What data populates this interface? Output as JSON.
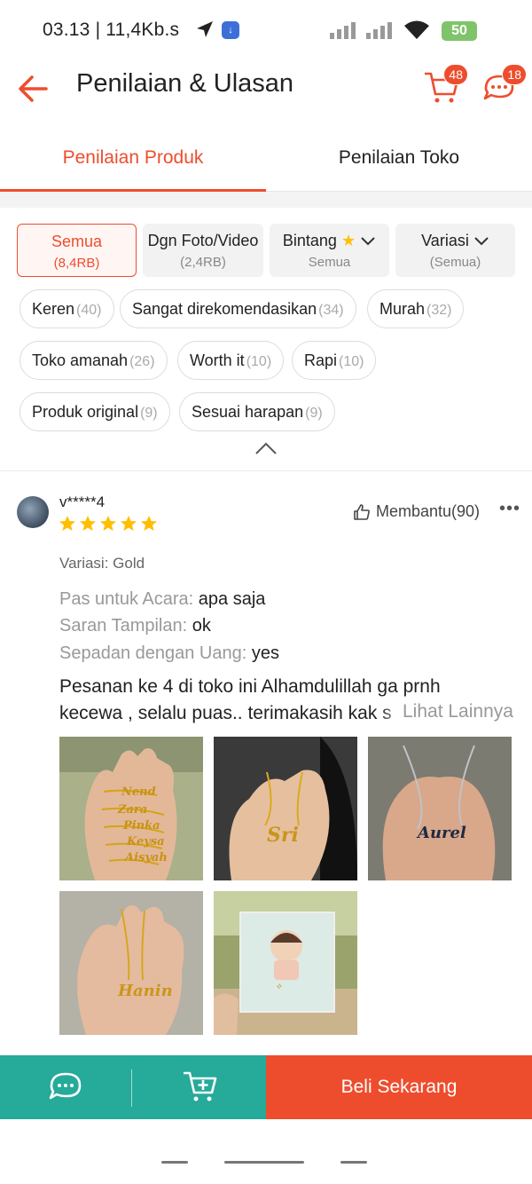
{
  "status_bar": {
    "time": "03.13 | 11,4Kb.s",
    "battery": "50"
  },
  "header": {
    "title": "Penilaian & Ulasan",
    "cart_count": "48",
    "chat_count": "18"
  },
  "tabs": [
    {
      "label": "Penilaian Produk",
      "active": true
    },
    {
      "label": "Penilaian Toko",
      "active": false
    }
  ],
  "filters": [
    {
      "label": "Semua",
      "sub": "(8,4RB)",
      "active": true
    },
    {
      "label": "Dgn Foto/Video",
      "sub": "(2,4RB)",
      "active": false
    },
    {
      "label": "Bintang",
      "sub": "Semua",
      "active": false
    },
    {
      "label": "Variasi",
      "sub": "(Semua)",
      "active": false
    }
  ],
  "chips": [
    {
      "label": "Keren",
      "count": "(40)"
    },
    {
      "label": "Sangat direkomendasikan",
      "count": "(34)"
    },
    {
      "label": "Murah",
      "count": "(32)"
    },
    {
      "label": "Toko amanah",
      "count": "(26)"
    },
    {
      "label": "Worth it",
      "count": "(10)"
    },
    {
      "label": "Rapi",
      "count": "(10)"
    },
    {
      "label": "Produk original",
      "count": "(9)"
    },
    {
      "label": "Sesuai harapan",
      "count": "(9)"
    }
  ],
  "review": {
    "username": "v*****4",
    "rating": 5,
    "helpful_label": "Membantu(90)",
    "variation": "Variasi: Gold",
    "attributes": [
      {
        "key": "Pas untuk Acara:",
        "value": "apa saja"
      },
      {
        "key": "Saran Tampilan:",
        "value": "ok"
      },
      {
        "key": "Sepadan dengan Uang:",
        "value": "yes"
      }
    ],
    "text_line1": "Pesanan ke 4 di toko ini Alhamdulillah ga prnh",
    "text_line2": "kecewa , selalu puas.. terimakasih kak s",
    "see_more": "Lihat Lainnya",
    "photo_names": [
      "Nend",
      "Zara",
      "Pinka",
      "Keysa",
      "Aisyah",
      "Sri",
      "Aurel",
      "Hanin"
    ]
  },
  "bottom_bar": {
    "buy_now": "Beli Sekarang"
  },
  "colors": {
    "accent": "#ee4d2d",
    "teal": "#26aa99",
    "star": "#ffbf00"
  }
}
